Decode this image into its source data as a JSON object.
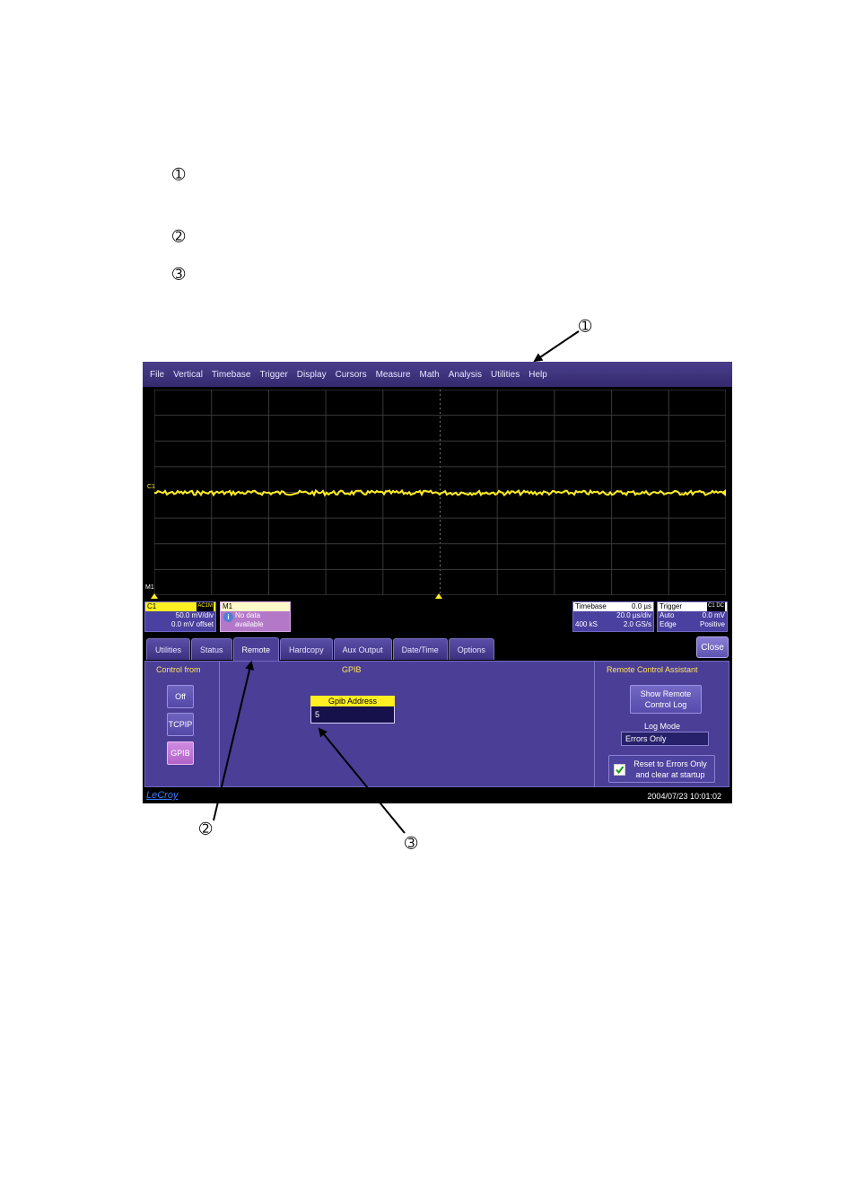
{
  "annotations": {
    "list_marker_1": "➀",
    "list_marker_2": "➁",
    "list_marker_3": "➂",
    "callout_1": "➀",
    "callout_2": "➁",
    "callout_3": "➂"
  },
  "menu": [
    "File",
    "Vertical",
    "Timebase",
    "Trigger",
    "Display",
    "Cursors",
    "Measure",
    "Math",
    "Analysis",
    "Utilities",
    "Help"
  ],
  "grid": {
    "c1_label": "C1",
    "m1_label": "M1",
    "trace_color": "#ffee22",
    "grid_color": "#3a3a3a"
  },
  "c1": {
    "title": "C1",
    "coupling": "AC1M",
    "scale": "50.0 mV/div",
    "offset": "0.0 mV offset"
  },
  "m1": {
    "title": "M1",
    "line1": "No data",
    "line2": "available"
  },
  "timebase": {
    "title": "Timebase",
    "delay": "0.0 µs",
    "per_div": "20.0 µs/div",
    "samples": "400 kS",
    "rate": "2.0 GS/s"
  },
  "trigger": {
    "title": "Trigger",
    "source": "C1 DC",
    "mode": "Auto",
    "level": "0.0 mV",
    "type": "Edge",
    "slope": "Positive"
  },
  "tabs": [
    "Utilities",
    "Status",
    "Remote",
    "Hardcopy",
    "Aux Output",
    "Date/Time",
    "Options"
  ],
  "active_tab": "Remote",
  "close_label": "Close",
  "control_from": {
    "title": "Control from",
    "options": [
      "Off",
      "TCPIP",
      "GPIB"
    ],
    "selected": "GPIB"
  },
  "gpib": {
    "title": "GPIB",
    "address_label": "Gpib Address",
    "address_value": "5"
  },
  "assistant": {
    "title": "Remote Control Assistant",
    "show_log_line1": "Show Remote",
    "show_log_line2": "Control Log",
    "log_mode_label": "Log Mode",
    "log_mode_value": "Errors Only",
    "reset_line1": "Reset to Errors Only",
    "reset_line2": "and clear at startup",
    "reset_checked": true
  },
  "status": {
    "logo": "LeCroy",
    "datetime": "2004/07/23 10:01:02"
  }
}
